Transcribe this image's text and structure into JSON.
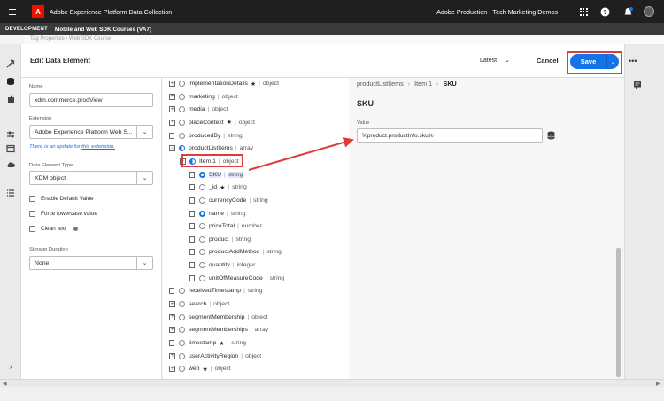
{
  "app": {
    "title": "Adobe Experience Platform Data Collection",
    "org": "Adobe Production - Tech Marketing Demos",
    "environment": "DEVELOPMENT",
    "property": "Mobile and Web SDK Courses (VA7)",
    "behind_text": "Tag Properties › Web SDK Course"
  },
  "header": {
    "title": "Edit Data Element",
    "latest": "Latest",
    "cancel": "Cancel",
    "save": "Save"
  },
  "form": {
    "name_label": "Name",
    "name_value": "xdm.commerce.prodView",
    "extension_label": "Extension",
    "extension_value": "Adobe Experience Platform Web S...",
    "update_text": "There is an update for",
    "update_link": "this extension.",
    "type_label": "Data Element Type",
    "type_value": "XDM object",
    "enable_default": "Enable Default Value",
    "force_lowercase": "Force lowercase value",
    "clean_text": "Clean text",
    "storage_label": "Storage Duration",
    "storage_value": "None"
  },
  "tree": [
    {
      "name": "implementationDetails",
      "type": "object",
      "star": true,
      "icon": "plus"
    },
    {
      "name": "marketing",
      "type": "object",
      "star": false,
      "icon": "plus"
    },
    {
      "name": "media",
      "type": "object",
      "star": false,
      "icon": "plus"
    },
    {
      "name": "placeContext",
      "type": "object",
      "star": true,
      "icon": "plus"
    },
    {
      "name": "producedBy",
      "type": "string",
      "star": false,
      "icon": "file"
    },
    {
      "name": "productListItems",
      "type": "array",
      "star": false,
      "icon": "minus"
    },
    {
      "name": "Item 1",
      "type": "object",
      "star": false,
      "icon": "minus"
    },
    {
      "name": "SKU",
      "type": "string",
      "star": false,
      "icon": "file"
    },
    {
      "name": "_id",
      "type": "string",
      "star": true,
      "icon": "file"
    },
    {
      "name": "currencyCode",
      "type": "string",
      "star": false,
      "icon": "file"
    },
    {
      "name": "name",
      "type": "string",
      "star": false,
      "icon": "file"
    },
    {
      "name": "priceTotal",
      "type": "number",
      "star": false,
      "icon": "file"
    },
    {
      "name": "product",
      "type": "string",
      "star": false,
      "icon": "file"
    },
    {
      "name": "productAddMethod",
      "type": "string",
      "star": false,
      "icon": "file"
    },
    {
      "name": "quantity",
      "type": "integer",
      "star": false,
      "icon": "file"
    },
    {
      "name": "unitOfMeasureCode",
      "type": "string",
      "star": false,
      "icon": "file"
    },
    {
      "name": "receivedTimestamp",
      "type": "string",
      "star": false,
      "icon": "file"
    },
    {
      "name": "search",
      "type": "object",
      "star": false,
      "icon": "plus"
    },
    {
      "name": "segmentMembership",
      "type": "object",
      "star": false,
      "icon": "plus"
    },
    {
      "name": "segmentMemberships",
      "type": "array",
      "star": false,
      "icon": "plus"
    },
    {
      "name": "timestamp",
      "type": "string",
      "star": true,
      "icon": "file"
    },
    {
      "name": "userActivityRegion",
      "type": "object",
      "star": false,
      "icon": "plus"
    },
    {
      "name": "web",
      "type": "object",
      "star": true,
      "icon": "plus"
    }
  ],
  "detail": {
    "bc1": "productListItems",
    "bc2": "Item 1",
    "bc3": "SKU",
    "title": "SKU",
    "value_label": "Value",
    "value": "%product.productInfo.sku%"
  },
  "colors": {
    "accent": "#1473e6",
    "highlight": "#e03b3b",
    "brand": "#eb1000"
  }
}
